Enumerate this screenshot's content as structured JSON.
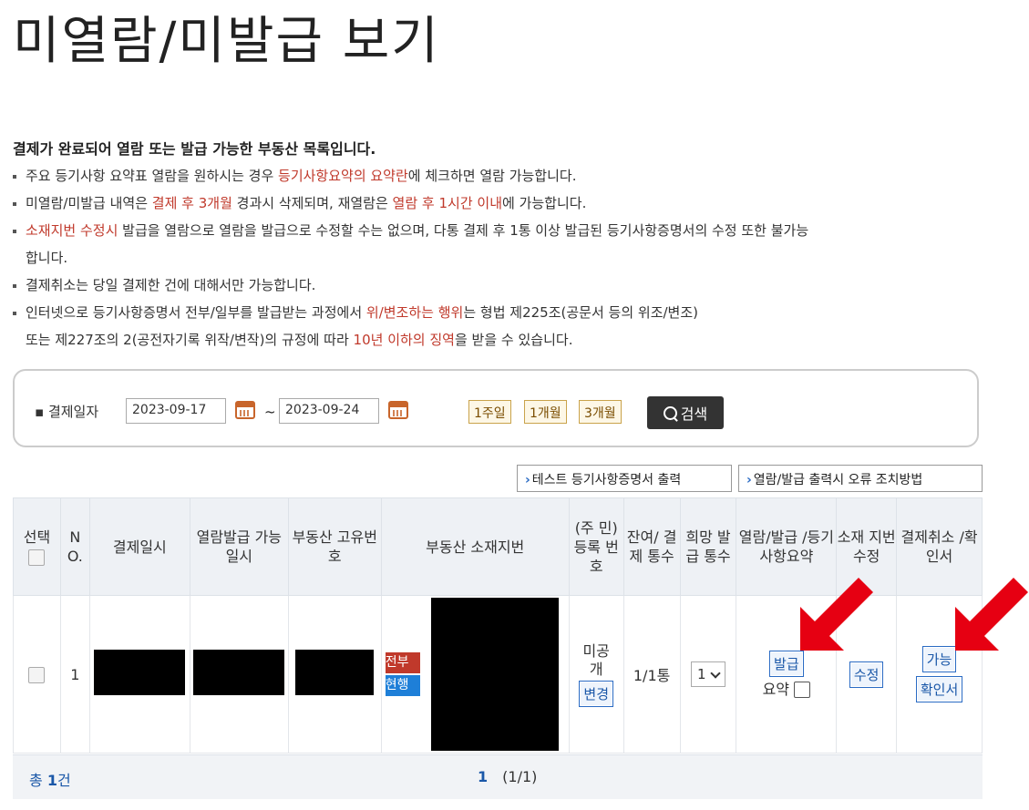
{
  "page": {
    "title": "미열람/미발급 보기"
  },
  "notice": {
    "heading": "결제가 완료되어 열람 또는 발급 가능한 부동산 목록입니다.",
    "items": [
      {
        "p1": "주요 등기사항 요약표 열람을 원하시는 경우 ",
        "h1": "등기사항요약의 요약란",
        "p2": "에 체크하면 열람 가능합니다."
      },
      {
        "p1": "미열람/미발급 내역은 ",
        "h1": "결제 후 3개월",
        "p2": " 경과시 삭제되며, 재열람은 ",
        "h2": "열람 후 1시간 이내",
        "p3": "에 가능합니다."
      },
      {
        "h1": "소재지번 수정시",
        "p1": " 발급을 열람으로 열람을 발급으로 수정할 수는 없으며, 다통 결제 후 1통 이상 발급된 등기사항증명서의 수정 또한 불가능"
      },
      {
        "p1": "합니다."
      },
      {
        "p1": "결제취소는 당일 결제한 건에 대해서만 가능합니다."
      },
      {
        "p1": "인터넷으로 등기사항증명서 전부/일부를 발급받는 과정에서 ",
        "h1": "위/변조하는 행위",
        "p2": "는 형법 제225조(공문서 등의 위조/변조)"
      },
      {
        "p1": "또는 제227조의 2(공전자기록 위작/변작)의 규정에 따라 ",
        "h1": "10년 이하의 징역",
        "p2": "을 받을 수 있습니다."
      }
    ]
  },
  "search": {
    "label": "결제일자",
    "start_date": "2023-09-17",
    "end_date": "2023-09-24",
    "tilde": "~",
    "periods": [
      "1주일",
      "1개월",
      "3개월"
    ],
    "button": "검색"
  },
  "tools": {
    "test_print": "테스트 등기사항증명서 출력",
    "error_guide": "열람/발급 출력시 오류 조치방법"
  },
  "table": {
    "headers": {
      "select": "선택",
      "no": "N O.",
      "paid_date": "결제일시",
      "available_date": "열람발급 가능일시",
      "unique_no": "부동산 고유번호",
      "address": "부동산 소재지번",
      "resident_no": "(주 민) 등록 번호",
      "remaining": "잔여/ 결제 통수",
      "desired": "희망 발급 통수",
      "view_issue": "열람/발급 /등기 사항요약",
      "edit_addr": "소재 지번 수정",
      "cancel": "결제취소 /확인서"
    },
    "row": {
      "no": "1",
      "badge_all": "전부",
      "badge_current": "현행",
      "resident_status": "미공개",
      "resident_change": "변경",
      "remaining": "1/1통",
      "desired": "1",
      "issue_btn": "발급",
      "summary_label": "요약",
      "edit_btn": "수정",
      "cancel_btn": "가능",
      "confirm_btn": "확인서"
    }
  },
  "footer": {
    "total_prefix": "총",
    "total_count": "1",
    "total_suffix": "건",
    "page_current": "1",
    "page_info": "(1/1)"
  },
  "colors": {
    "highlight": "#c0392b",
    "link": "#1a57a8",
    "badge_all": "#c0392b",
    "badge_current": "#1e7fd8",
    "arrow": "#e60012"
  }
}
